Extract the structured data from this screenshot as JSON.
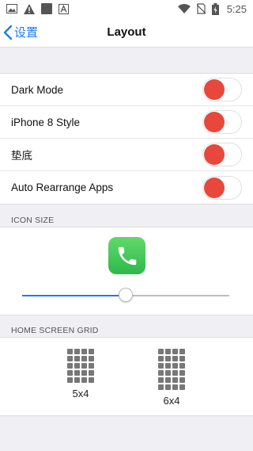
{
  "status": {
    "time": "5:25"
  },
  "nav": {
    "back_label": "设置",
    "title": "Layout"
  },
  "settings": [
    {
      "label": "Dark Mode"
    },
    {
      "label": "iPhone 8 Style"
    },
    {
      "label": "垫底"
    },
    {
      "label": "Auto Rearrange Apps"
    }
  ],
  "icon_size": {
    "header": "ICON SIZE",
    "slider_value_percent": 50
  },
  "home_grid": {
    "header": "HOME SCREEN GRID",
    "options": [
      {
        "label": "5x4"
      },
      {
        "label": "6x4"
      }
    ]
  },
  "colors": {
    "accent": "#1a7cf0",
    "toggle_knob": "#e8483c",
    "phone_green": "#34c759"
  }
}
